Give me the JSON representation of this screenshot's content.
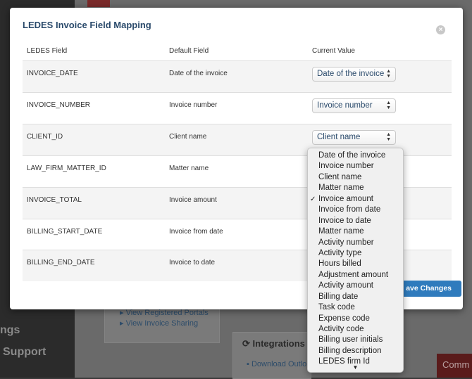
{
  "background": {
    "sidebar_items": [
      "ngs",
      "Support"
    ],
    "links": [
      "View Registered Portals",
      "View Invoice Sharing"
    ],
    "integrations_title": "Integrations",
    "integrations_link": "Download Outlo",
    "red_button": "Comm"
  },
  "modal": {
    "title": "LEDES Invoice Field Mapping",
    "close_glyph": "×",
    "headers": {
      "ledes": "LEDES Field",
      "default": "Default Field",
      "current": "Current Value"
    },
    "rows": [
      {
        "ledes": "INVOICE_DATE",
        "default": "Date of the invoice",
        "current": "Date of the invoice"
      },
      {
        "ledes": "INVOICE_NUMBER",
        "default": "Invoice number",
        "current": "Invoice number"
      },
      {
        "ledes": "CLIENT_ID",
        "default": "Client name",
        "current": "Client name"
      },
      {
        "ledes": "LAW_FIRM_MATTER_ID",
        "default": "Matter name",
        "current": ""
      },
      {
        "ledes": "INVOICE_TOTAL",
        "default": "Invoice amount",
        "current": ""
      },
      {
        "ledes": "BILLING_START_DATE",
        "default": "Invoice from date",
        "current": ""
      },
      {
        "ledes": "BILLING_END_DATE",
        "default": "Invoice to date",
        "current": ""
      }
    ],
    "save_label": "ave Changes"
  },
  "dropdown": {
    "checked_glyph": "✓",
    "scroll_down_glyph": "▼",
    "options": [
      "Date of the invoice",
      "Invoice number",
      "Client name",
      "Matter name",
      "Invoice amount",
      "Invoice from date",
      "Invoice to date",
      "Matter name",
      "Activity number",
      "Activity type",
      "Hours billed",
      "Adjustment amount",
      "Activity amount",
      "Billing date",
      "Task code",
      "Expense code",
      "Activity code",
      "Billing user initials",
      "Billing description",
      "LEDES firm Id"
    ],
    "selected_index": 4
  },
  "colors": {
    "accent": "#2f7bbd",
    "title": "#2a4a6b"
  }
}
